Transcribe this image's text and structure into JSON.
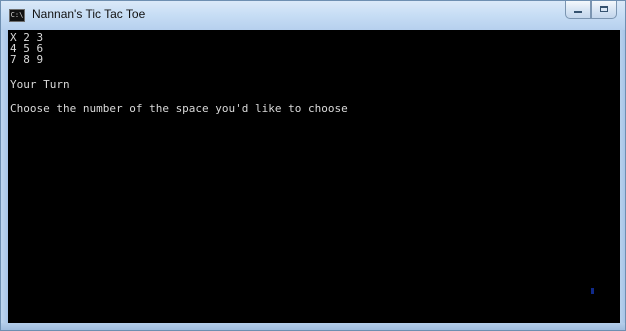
{
  "window": {
    "title": "Nannan's Tic Tac Toe",
    "icon_text": "C:\\"
  },
  "console": {
    "board": [
      "X 2 3",
      "4 5 6",
      "7 8 9"
    ],
    "status": "Your Turn",
    "prompt": "Choose the number of the space you'd like to choose"
  },
  "controls": {
    "minimize_icon": "minimize-icon",
    "maximize_icon": "maximize-icon"
  },
  "colors": {
    "console_background": "#000000",
    "console_text": "#d9d9d9",
    "titlebar": "#c8def5",
    "cursor": "#102a8a"
  }
}
